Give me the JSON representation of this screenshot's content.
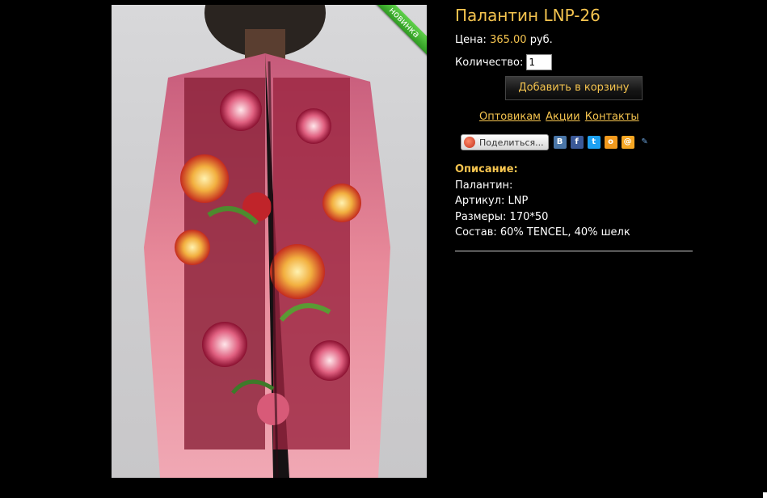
{
  "product": {
    "title": "Палантин LNP-26",
    "badge": "новинка",
    "price_label": "Цена:",
    "price_value": "365.00",
    "price_currency": "руб.",
    "quantity_label": "Количество:",
    "quantity_value": "1",
    "add_to_cart_label": "Добавить в корзину"
  },
  "links": {
    "wholesale": "Оптовикам",
    "promotions": "Акции",
    "contacts": "Контакты"
  },
  "share": {
    "button_label": "Поделиться...",
    "icons": [
      "vkontakte-icon",
      "facebook-icon",
      "twitter-icon",
      "odnoklassniki-icon",
      "mail-ru-icon",
      "livejournal-icon"
    ]
  },
  "description": {
    "heading": "Описание:",
    "line1": "Палантин:",
    "line2": "Артикул: LNP",
    "line3": "Размеры: 170*50",
    "line4": "Состав: 60% TENCEL, 40% шелк"
  },
  "colors": {
    "accent": "#f5c44f",
    "background": "#000000",
    "badge_green": "#3faf2c"
  }
}
